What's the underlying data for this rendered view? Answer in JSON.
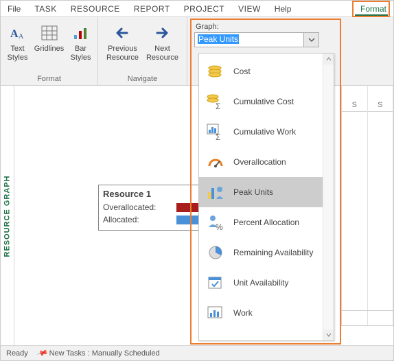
{
  "menu": {
    "file": "File",
    "task": "TASK",
    "resource": "RESOURCE",
    "report": "REPORT",
    "project": "PROJECT",
    "view": "VIEW",
    "help": "Help",
    "format": "Format"
  },
  "ribbon": {
    "format_group": {
      "label": "Format",
      "text_styles": "Text\nStyles",
      "gridlines": "Gridlines",
      "bar_styles": "Bar\nStyles"
    },
    "navigate_group": {
      "label": "Navigate",
      "prev": "Previous\nResource",
      "next": "Next\nResource"
    },
    "graph": {
      "label": "Graph:",
      "selected": "Peak Units"
    }
  },
  "dropdown": {
    "items": [
      {
        "label": "Cost",
        "selected": false
      },
      {
        "label": "Cumulative Cost",
        "selected": false
      },
      {
        "label": "Cumulative Work",
        "selected": false
      },
      {
        "label": "Overallocation",
        "selected": false
      },
      {
        "label": "Peak Units",
        "selected": true
      },
      {
        "label": "Percent Allocation",
        "selected": false
      },
      {
        "label": "Remaining Availability",
        "selected": false
      },
      {
        "label": "Unit Availability",
        "selected": false
      },
      {
        "label": "Work",
        "selected": false
      }
    ]
  },
  "left_rail": "RESOURCE GRAPH",
  "legend": {
    "title": "Resource 1",
    "rows": [
      {
        "label": "Overallocated:",
        "color": "#a91d1d"
      },
      {
        "label": "Allocated:",
        "color": "#4a90d9"
      }
    ]
  },
  "right_headers": {
    "c1": "S",
    "c2": "S"
  },
  "status": {
    "ready": "Ready",
    "tasks": "New Tasks : Manually Scheduled"
  }
}
